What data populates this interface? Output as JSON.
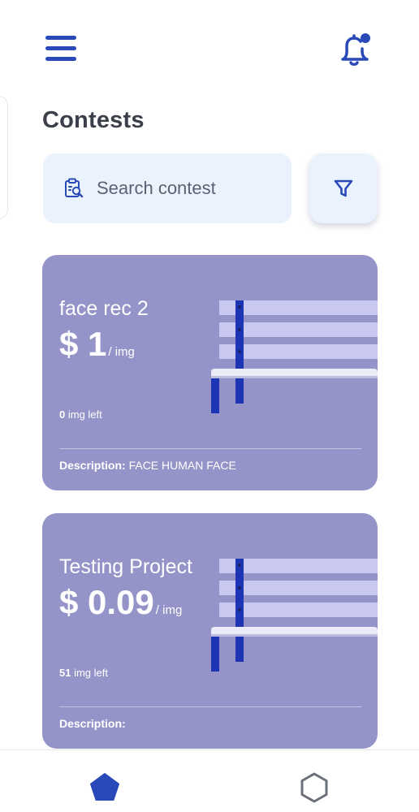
{
  "header": {
    "menu_icon": "hamburger-menu-icon",
    "notification_icon": "bell-notification-icon",
    "title": "Contests"
  },
  "search": {
    "icon": "clipboard-search-icon",
    "placeholder": "Search contest",
    "value": "",
    "filter_icon": "funnel-filter-icon"
  },
  "contests": [
    {
      "name": "face rec 2",
      "currency": "$",
      "price": "1",
      "unit": "/ img",
      "images_left": "0",
      "images_left_label": "img left",
      "description_label": "Description:",
      "description": "FACE HUMAN FACE"
    },
    {
      "name": "Testing Project",
      "currency": "$",
      "price": "0.09",
      "unit": "/ img",
      "images_left": "51",
      "images_left_label": "img left",
      "description_label": "Description:",
      "description": ""
    }
  ],
  "bottom_nav": {
    "items": [
      {
        "icon": "pentagon-home-icon",
        "active": true
      },
      {
        "icon": "hexagon-icon",
        "active": false
      }
    ]
  },
  "colors": {
    "accent": "#2a49b8",
    "card_bg": "#9494c9",
    "search_bg": "#eaf3fd",
    "title_text": "#3b3f4a"
  }
}
